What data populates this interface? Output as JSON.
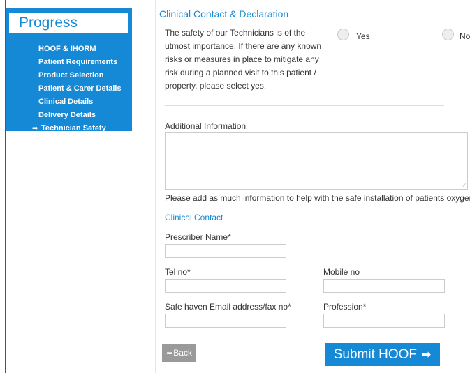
{
  "sidebar": {
    "title": "Progress",
    "items": [
      {
        "label": "HOOF & IHORM",
        "active": false
      },
      {
        "label": "Patient Requirements",
        "active": false
      },
      {
        "label": "Product Selection",
        "active": false
      },
      {
        "label": "Patient & Carer Details",
        "active": false
      },
      {
        "label": "Clinical Details",
        "active": false
      },
      {
        "label": "Delivery Details",
        "active": false
      },
      {
        "label": "Technician Safety",
        "active": true,
        "icon": "arrow-right-icon"
      }
    ]
  },
  "declaration": {
    "title": "Clinical Contact & Declaration",
    "text": "The safety of our Technicians is of the utmost importance. If there are any known risks or measures in place to mitigate any risk during a planned visit to this patient / property, please select yes.",
    "yes_label": "Yes",
    "no_label": "No"
  },
  "additional_info": {
    "label": "Additional Information",
    "value": "",
    "help": "Please add as much information to help with the safe installation of patients oxygen"
  },
  "clinical_contact": {
    "title": "Clinical Contact",
    "prescriber_label": "Prescriber Name*",
    "tel_label": "Tel no*",
    "mobile_label": "Mobile no",
    "email_label": "Safe haven Email address/fax no*",
    "profession_label": "Profession*"
  },
  "buttons": {
    "back": "Back",
    "submit": "Submit HOOF"
  },
  "colors": {
    "accent": "#1589d6",
    "back_button": "#9a9a9a"
  }
}
